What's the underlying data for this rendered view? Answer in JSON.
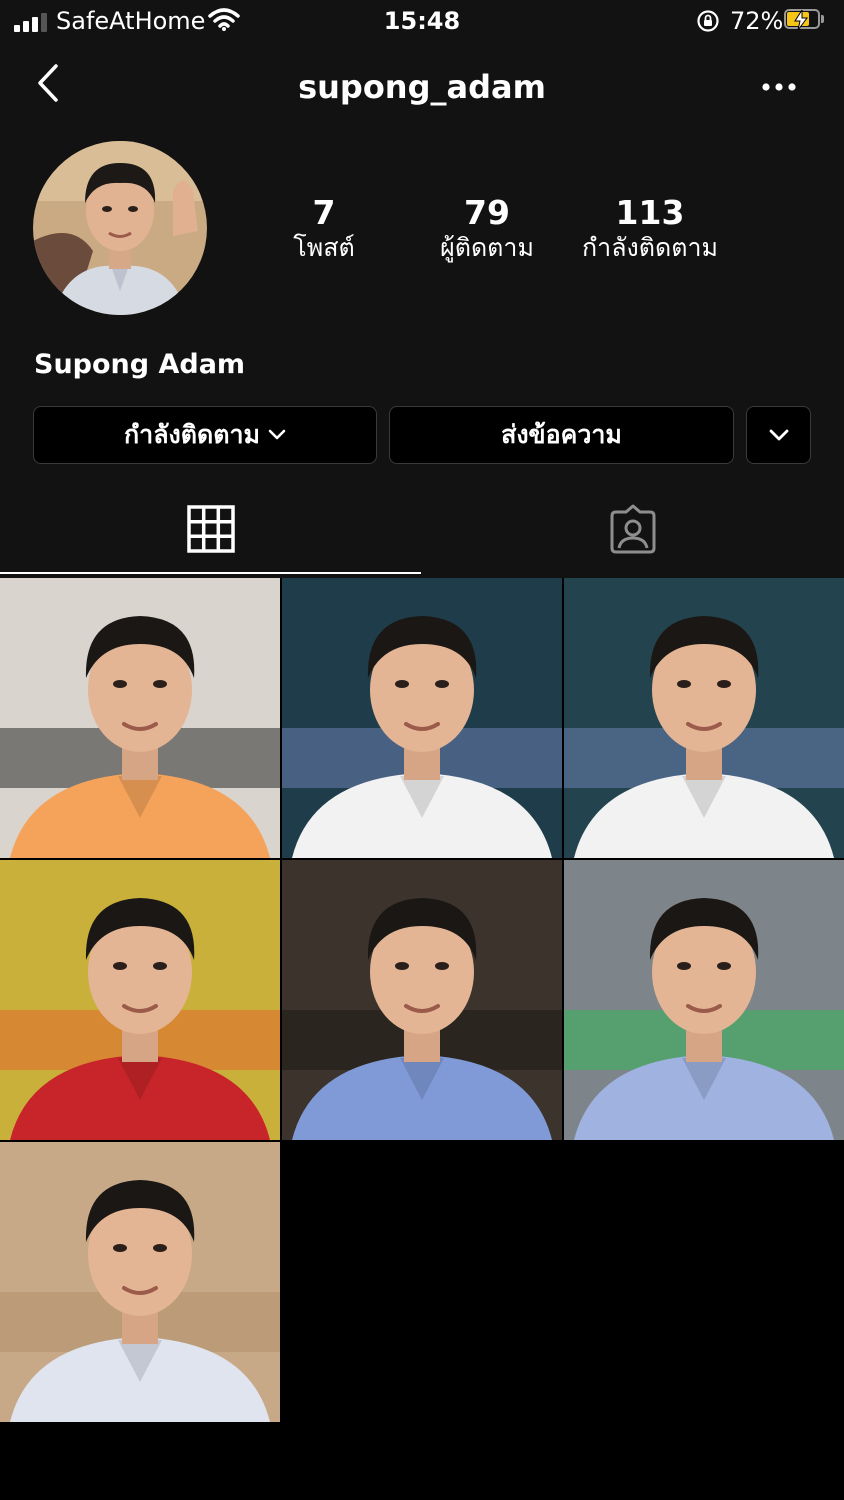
{
  "status_bar": {
    "carrier": "SafeAtHome",
    "time": "15:48",
    "battery_percent": "72%",
    "battery_level": 0.72,
    "signal_bars": 3
  },
  "header": {
    "username": "supong_adam",
    "back_icon": "chevron-left-icon",
    "more_icon": "more-horizontal-icon"
  },
  "profile": {
    "posts_count": "7",
    "posts_label": "โพสต์",
    "followers_count": "79",
    "followers_label": "ผู้ติดตาม",
    "following_count": "113",
    "following_label": "กำลังติดตาม",
    "display_name": "Supong Adam"
  },
  "actions": {
    "following_button": "กำลังติดตาม",
    "message_button": "ส่งข้อความ"
  },
  "tabs": [
    {
      "name": "posts",
      "icon": "grid-icon",
      "active": true
    },
    {
      "name": "tagged",
      "icon": "tagged-person-icon",
      "active": false
    }
  ],
  "posts": [
    {
      "shirt": "#f5a35a",
      "bg": "#d9d4cd",
      "accent": "#2b2b2b"
    },
    {
      "shirt": "#f2f2f2",
      "bg": "#1e3c4a",
      "accent": "#6b7fb0"
    },
    {
      "shirt": "#f2f2f2",
      "bg": "#23444f",
      "accent": "#6b7fb0"
    },
    {
      "shirt": "#c8252a",
      "bg": "#c9b03a",
      "accent": "#e06a2b"
    },
    {
      "shirt": "#7f9ad6",
      "bg": "#3c332c",
      "accent": "#1d1a17"
    },
    {
      "shirt": "#9fb2e0",
      "bg": "#7e858a",
      "accent": "#34b55a"
    },
    {
      "shirt": "#dfe4ef",
      "bg": "#c8a987",
      "accent": "#b2906c"
    }
  ]
}
